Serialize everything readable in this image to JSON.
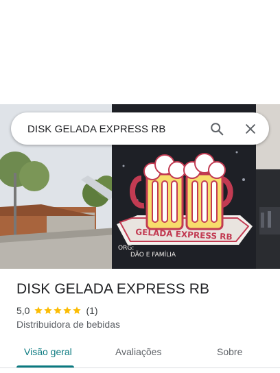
{
  "search": {
    "query": "DISK GELADA EXPRESS RB",
    "search_icon": "search-icon",
    "close_icon": "close-icon"
  },
  "hero": {
    "sign_text": "GELADA EXPRESS RB",
    "sign_footer_left": "ORG:",
    "sign_footer_right": "DÃO E FAMÍLIA"
  },
  "place": {
    "name": "DISK GELADA EXPRESS RB",
    "rating": "5,0",
    "stars": 5,
    "review_count": "(1)",
    "category": "Distribuidora de bebidas"
  },
  "tabs": [
    {
      "label": "Visão geral",
      "active": true
    },
    {
      "label": "Avaliações",
      "active": false
    },
    {
      "label": "Sobre",
      "active": false
    }
  ],
  "colors": {
    "accent": "#0b7a80",
    "star": "#fbbc04"
  }
}
